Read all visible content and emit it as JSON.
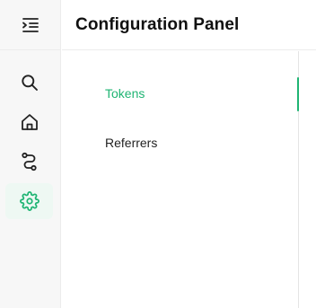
{
  "header": {
    "title": "Configuration Panel"
  },
  "rail": {
    "collapse_icon": "menu-collapse-icon",
    "items": [
      {
        "icon": "search-icon",
        "active": false
      },
      {
        "icon": "home-icon",
        "active": false
      },
      {
        "icon": "route-icon",
        "active": false
      },
      {
        "icon": "gear-icon",
        "active": true
      }
    ]
  },
  "nav": {
    "items": [
      {
        "label": "Tokens",
        "active": true
      },
      {
        "label": "Referrers",
        "active": false
      }
    ]
  },
  "colors": {
    "accent": "#1fb473",
    "accent_bg": "#eef8f3",
    "rail_bg": "#f7f7f7",
    "text": "#1f1f1f"
  }
}
